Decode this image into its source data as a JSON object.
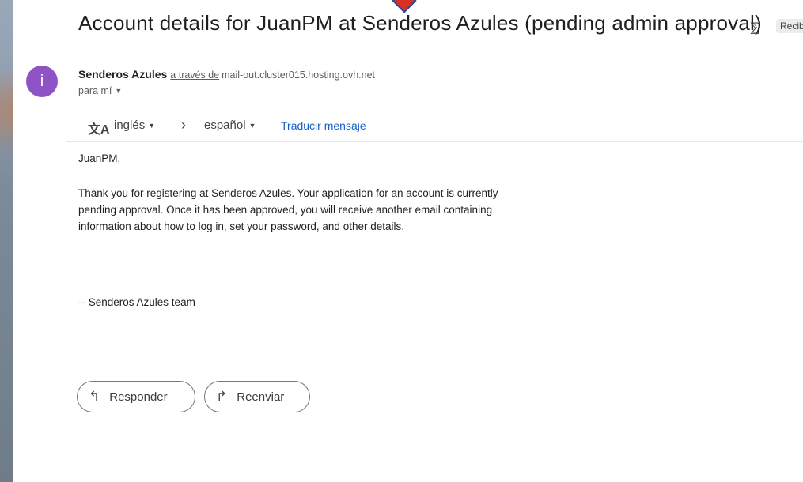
{
  "email": {
    "subject": "Account details for JuanPM at Senderos Azules (pending admin approval)",
    "subject_icon": "important-marker-icon",
    "label_chip": "Recibid",
    "avatar_letter": "i",
    "sender_name": "Senderos Azules",
    "via_text": "a través de",
    "via_host": "mail-out.cluster015.hosting.ovh.net",
    "to_text": "para mí"
  },
  "translate": {
    "from_lang": "inglés",
    "to_lang": "español",
    "action": "Traducir mensaje"
  },
  "body": {
    "greeting": "JuanPM,",
    "paragraph": "Thank you for registering at Senderos Azules. Your application for an account is currently pending approval. Once it has been approved, you will receive another email containing information about how to log in, set your password, and other details.",
    "signature": "-- Senderos Azules team"
  },
  "actions": {
    "reply": "Responder",
    "forward": "Reenviar"
  },
  "colors": {
    "avatar": "#8e53c5",
    "link": "#1a5fc9"
  }
}
